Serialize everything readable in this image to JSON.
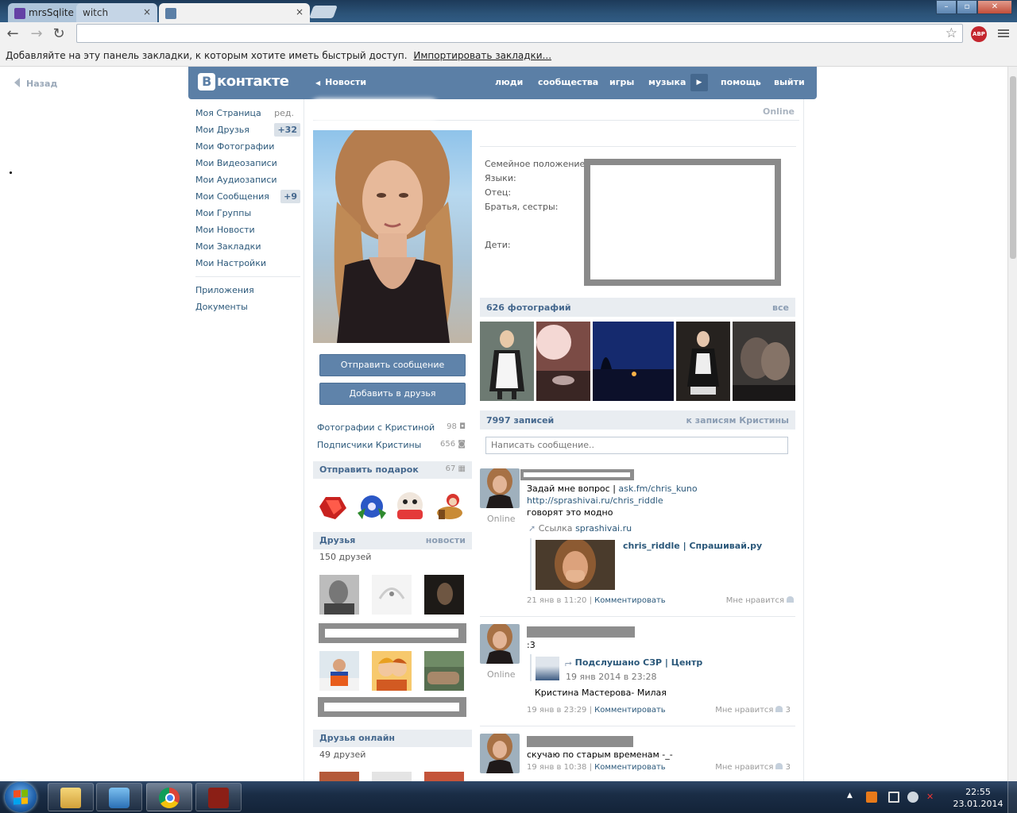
{
  "browser": {
    "tabs": [
      {
        "title": "mrsSqlite - ",
        "icon": "twitch-icon"
      },
      {
        "title": "witch",
        "icon": "none"
      },
      {
        "title": "",
        "icon": "vk-icon"
      }
    ],
    "url": "",
    "bookmarks_bar": {
      "text": "Добавляйте на эту панель закладки, к которым хотите иметь быстрый доступ.",
      "link": "Импортировать закладки..."
    },
    "abp_label": "ABP"
  },
  "page": {
    "back_link": "Назад"
  },
  "vk": {
    "logo_text": "контакте",
    "logo_letter": "В",
    "news": "Новости",
    "nav": [
      "люди",
      "сообщества",
      "игры",
      "музыка",
      "помощь",
      "выйти"
    ]
  },
  "left_menu": {
    "items": [
      {
        "label": "Моя Страница",
        "extra": "ред."
      },
      {
        "label": "Мои Друзья",
        "count": "+32"
      },
      {
        "label": "Мои Фотографии"
      },
      {
        "label": "Мои Видеозаписи"
      },
      {
        "label": "Мои Аудиозаписи"
      },
      {
        "label": "Мои Сообщения",
        "count": "+9"
      },
      {
        "label": "Мои Группы"
      },
      {
        "label": "Мои Новости"
      },
      {
        "label": "Мои Закладки"
      },
      {
        "label": "Мои Настройки"
      }
    ],
    "extra_items": [
      "Приложения",
      "Документы"
    ]
  },
  "profile": {
    "status": "Online",
    "send_message": "Отправить сообщение",
    "add_friend": "Добавить в друзья",
    "photos_with": {
      "label": "Фотографии с Кристиной",
      "count": "98"
    },
    "followers": {
      "label": "Подписчики Кристины",
      "count": "656"
    },
    "gifts": {
      "title": "Отправить подарок",
      "count": "67"
    },
    "friends": {
      "title": "Друзья",
      "link": "новости",
      "count": "150 друзей"
    },
    "friends_online": {
      "title": "Друзья онлайн",
      "count": "49 друзей"
    },
    "info_labels": [
      "Семейное положение:",
      "Языки:",
      "Отец:",
      "Братья, сестры:",
      "Дети:"
    ],
    "photos_header": {
      "title": "626 фотографий",
      "link": "все"
    },
    "wall_header": {
      "title": "7997 записей",
      "link": "к записям Кристины"
    },
    "wall_placeholder": "Написать сообщение.."
  },
  "posts": [
    {
      "status": "Online",
      "lines": [
        "Задай мне вопрос | ",
        "ask.fm/chris_kuno",
        "http://sprashivai.ru/chris_riddle",
        "говорят это модно"
      ],
      "link_label": "Ссылка",
      "link_domain": "sprashivai.ru",
      "attachment_title": "chris_riddle | Спрашивай.ру",
      "date": "21 янв в 11:20",
      "comment": "Комментировать",
      "like": "Мне нравится",
      "likes": ""
    },
    {
      "status": "Online",
      "text": ":3",
      "repost_title": "Подслушано СЗР | Центр",
      "repost_date": "19 янв 2014 в 23:28",
      "repost_text": "Кристина Мастерова- Милая",
      "date": "19 янв в 23:29",
      "comment": "Комментировать",
      "like": "Мне нравится",
      "likes": "3"
    },
    {
      "text": "скучаю по старым временам -_-",
      "date": "19 янв в 10:38",
      "comment": "Комментировать",
      "like": "Мне нравится",
      "likes": "3"
    }
  ],
  "taskbar": {
    "time": "22:55",
    "date": "23.01.2014"
  },
  "colors": {
    "vk_blue": "#5b7fa6",
    "link": "#2b587a",
    "header_bg": "#e9edf1"
  }
}
